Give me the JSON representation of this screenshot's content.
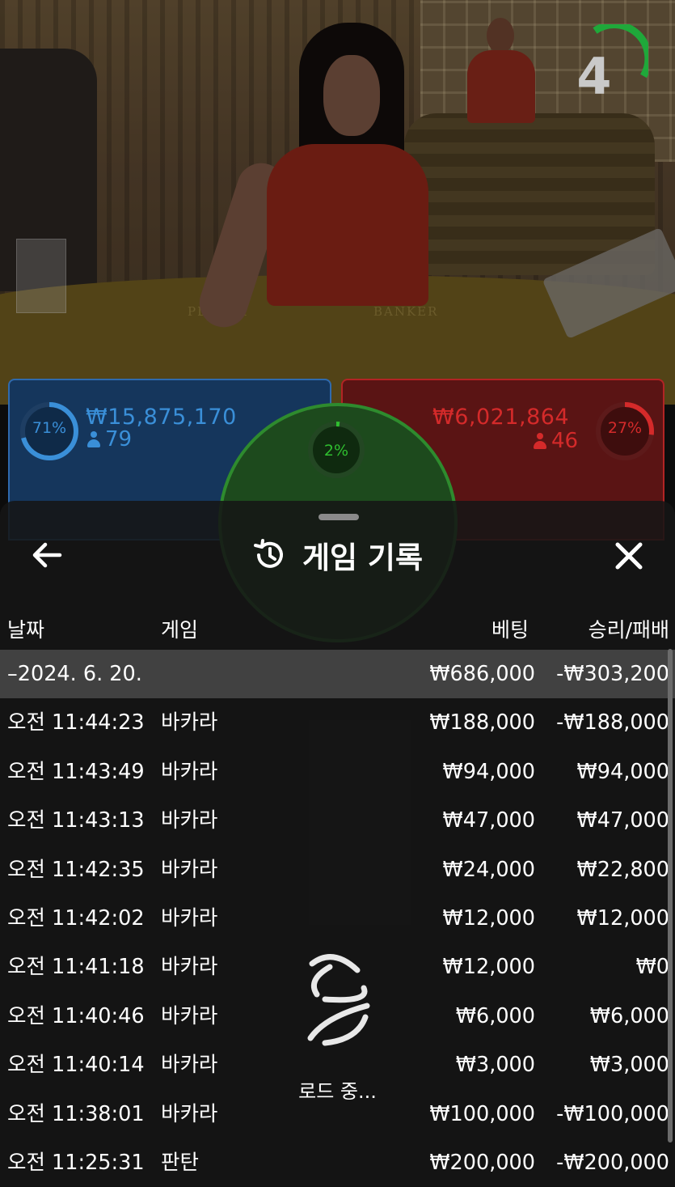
{
  "scene": {
    "table_labels": {
      "player": "PLAYER",
      "banker": "BANKER"
    },
    "timer": {
      "seconds": "4",
      "color": "#1fa83a"
    }
  },
  "bets": {
    "player": {
      "percent": "71%",
      "amount": "₩15,875,170",
      "players": "79",
      "color": "#3a8fd8"
    },
    "banker": {
      "percent": "27%",
      "amount": "₩6,021,864",
      "players": "46",
      "color": "#d42a2a"
    },
    "tie": {
      "percent": "2%",
      "color": "#2fbf2f"
    }
  },
  "history": {
    "title": "게임 기록",
    "icons": {
      "back": "arrow-left-icon",
      "title": "history-icon",
      "close": "close-icon"
    },
    "columns": {
      "date": "날짜",
      "game": "게임",
      "bet": "베팅",
      "result": "승리/패배"
    },
    "summary": {
      "date": "–2024. 6. 20.",
      "bet": "₩686,000",
      "result": "-₩303,200"
    },
    "rows": [
      {
        "time": "오전 11:44:23",
        "game": "바카라",
        "bet": "₩188,000",
        "result": "-₩188,000"
      },
      {
        "time": "오전 11:43:49",
        "game": "바카라",
        "bet": "₩94,000",
        "result": "₩94,000"
      },
      {
        "time": "오전 11:43:13",
        "game": "바카라",
        "bet": "₩47,000",
        "result": "₩47,000"
      },
      {
        "time": "오전 11:42:35",
        "game": "바카라",
        "bet": "₩24,000",
        "result": "₩22,800"
      },
      {
        "time": "오전 11:42:02",
        "game": "바카라",
        "bet": "₩12,000",
        "result": "₩12,000"
      },
      {
        "time": "오전 11:41:18",
        "game": "바카라",
        "bet": "₩12,000",
        "result": "₩0"
      },
      {
        "time": "오전 11:40:46",
        "game": "바카라",
        "bet": "₩6,000",
        "result": "₩6,000"
      },
      {
        "time": "오전 11:40:14",
        "game": "바카라",
        "bet": "₩3,000",
        "result": "₩3,000"
      },
      {
        "time": "오전 11:38:01",
        "game": "바카라",
        "bet": "₩100,000",
        "result": "-₩100,000"
      },
      {
        "time": "오전 11:25:31",
        "game": "판탄",
        "bet": "₩200,000",
        "result": "-₩200,000"
      }
    ],
    "loading_text": "로드 중..."
  }
}
